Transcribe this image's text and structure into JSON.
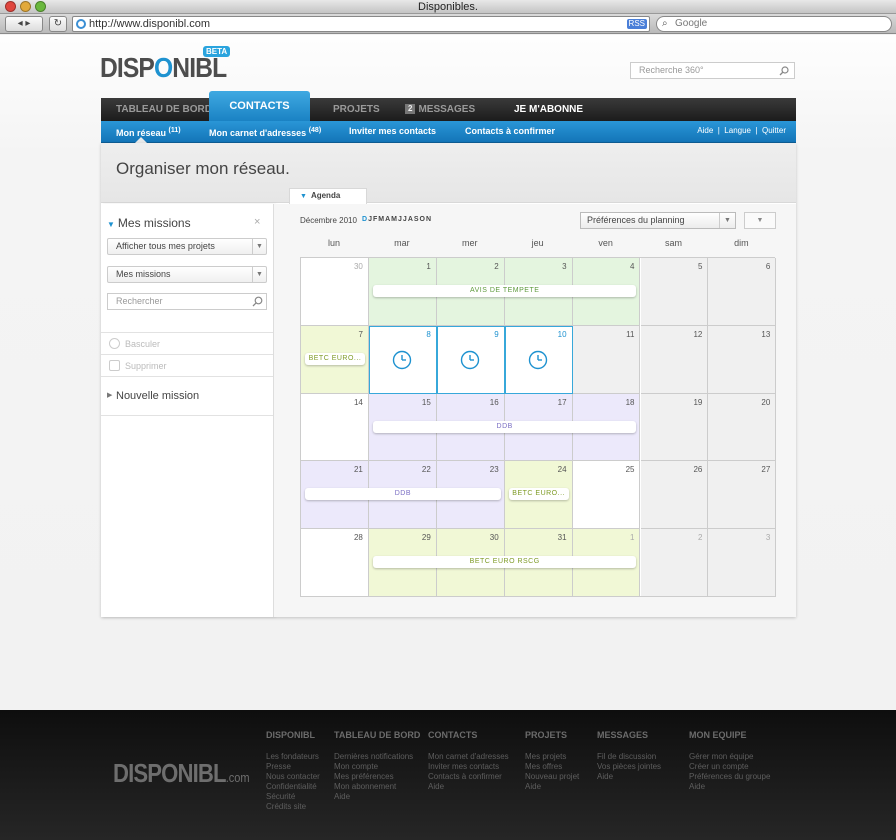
{
  "browser": {
    "window_title": "Disponibles.",
    "url": "http://www.disponibl.com",
    "rss": "RSS",
    "search_placeholder": "Google"
  },
  "brand": {
    "logo_pre": "DISP",
    "logo_o": "O",
    "logo_post": "NIBL",
    "beta": "BETA",
    "accent": "#1e92d0"
  },
  "header": {
    "search_placeholder": "Recherche 360°"
  },
  "nav": {
    "tab_dashboard": "TABLEAU DE BORD",
    "tab_contacts": "CONTACTS",
    "tab_projects": "PROJETS",
    "messages_count": "2",
    "tab_messages": "MESSAGES",
    "tab_subscribe": "JE M'ABONNE"
  },
  "subnav": {
    "network": "Mon réseau",
    "network_count": "(11)",
    "addressbook": "Mon carnet d'adresses",
    "addressbook_count": "(48)",
    "invite": "Inviter mes contacts",
    "confirm": "Contacts à confirmer",
    "help": "Aide",
    "sep": "|",
    "language": "Langue",
    "quit": "Quitter"
  },
  "page": {
    "title": "Organiser mon réseau.",
    "tab_agenda": "Agenda"
  },
  "sidebar": {
    "heading": "Mes missions",
    "close": "×",
    "filter_projects": "Afficher tous mes projets",
    "filter_missions": "Mes missions",
    "search_placeholder": "Rechercher",
    "action_toggle": "Basculer",
    "action_delete": "Supprimer",
    "new_mission": "Nouvelle mission"
  },
  "calendar": {
    "month_label": "Décembre 2010",
    "month_letters": [
      "D",
      "J",
      "F",
      "M",
      "A",
      "M",
      "J",
      "J",
      "A",
      "S",
      "O",
      "N"
    ],
    "current_month_index": 0,
    "prefs_label": "Préférences du planning",
    "days": [
      "lun",
      "mar",
      "mer",
      "jeu",
      "ven",
      "sam",
      "dim"
    ],
    "weeks": [
      [
        {
          "d": "30",
          "s": "dim"
        },
        {
          "d": "1",
          "s": "green"
        },
        {
          "d": "2",
          "s": "green"
        },
        {
          "d": "3",
          "s": "green"
        },
        {
          "d": "4",
          "s": "green"
        },
        {
          "d": "5",
          "s": "gray"
        },
        {
          "d": "6",
          "s": "gray"
        }
      ],
      [
        {
          "d": "7",
          "s": "lime"
        },
        {
          "d": "8",
          "s": "sel"
        },
        {
          "d": "9",
          "s": "sel"
        },
        {
          "d": "10",
          "s": "sel"
        },
        {
          "d": "11",
          "s": "gray"
        },
        {
          "d": "12",
          "s": "gray"
        },
        {
          "d": "13",
          "s": "gray"
        }
      ],
      [
        {
          "d": "14",
          "s": ""
        },
        {
          "d": "15",
          "s": "purple"
        },
        {
          "d": "16",
          "s": "purple"
        },
        {
          "d": "17",
          "s": "purple"
        },
        {
          "d": "18",
          "s": "purple"
        },
        {
          "d": "19",
          "s": "gray"
        },
        {
          "d": "20",
          "s": "gray"
        }
      ],
      [
        {
          "d": "21",
          "s": "purple"
        },
        {
          "d": "22",
          "s": "purple"
        },
        {
          "d": "23",
          "s": "purple"
        },
        {
          "d": "24",
          "s": "lime"
        },
        {
          "d": "25",
          "s": ""
        },
        {
          "d": "26",
          "s": "gray"
        },
        {
          "d": "27",
          "s": "gray"
        }
      ],
      [
        {
          "d": "28",
          "s": ""
        },
        {
          "d": "29",
          "s": "lime"
        },
        {
          "d": "30",
          "s": "lime"
        },
        {
          "d": "31",
          "s": "lime"
        },
        {
          "d": "1",
          "s": "limedim"
        },
        {
          "d": "2",
          "s": "graydim"
        },
        {
          "d": "3",
          "s": "graydim"
        }
      ]
    ],
    "events": [
      {
        "label": "AVIS DE TEMPETE",
        "week": 0,
        "start": 1,
        "end": 4,
        "color": "green"
      },
      {
        "label": "BETC EURO...",
        "week": 1,
        "start": 0,
        "end": 0,
        "color": "lime"
      },
      {
        "label": "DDB",
        "week": 2,
        "start": 1,
        "end": 4,
        "color": "purple"
      },
      {
        "label": "DDB",
        "week": 3,
        "start": 0,
        "end": 2,
        "color": "purple"
      },
      {
        "label": "BETC EURO...",
        "week": 3,
        "start": 3,
        "end": 3,
        "color": "lime"
      },
      {
        "label": "BETC EURO RSCG",
        "week": 4,
        "start": 1,
        "end": 4,
        "color": "lime"
      }
    ]
  },
  "footer": {
    "logo": "DISPONIBL",
    "logo_suffix": ".com",
    "columns": [
      {
        "title": "DISPONIBL",
        "links": [
          "Les fondateurs",
          "Presse",
          "Nous contacter",
          "Confidentialité",
          "Sécurité",
          "Crédits site"
        ]
      },
      {
        "title": "TABLEAU DE BORD",
        "links": [
          "Dernières notifications",
          "Mon compte",
          "Mes préférences",
          "Mon abonnement",
          "Aide"
        ]
      },
      {
        "title": "CONTACTS",
        "links": [
          "Mon carnet d'adresses",
          "Inviter mes contacts",
          "Contacts à confirmer",
          "Aide"
        ]
      },
      {
        "title": "PROJETS",
        "links": [
          "Mes projets",
          "Mes offres",
          "Nouveau projet",
          "Aide"
        ]
      },
      {
        "title": "MESSAGES",
        "links": [
          "Fil de discussion",
          "Vos pièces jointes",
          "Aide"
        ]
      },
      {
        "title": "MON EQUIPE",
        "links": [
          "Gérer mon équipe",
          "Créer un compte",
          "Préférences du groupe",
          "Aide"
        ]
      }
    ]
  }
}
